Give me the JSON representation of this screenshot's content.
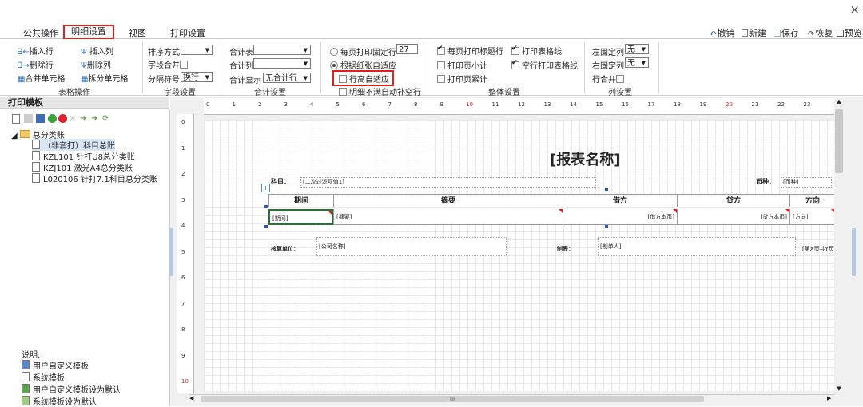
{
  "window": {
    "close": "×"
  },
  "tabs": [
    "公共操作",
    "明细设置",
    "视图",
    "打印设置"
  ],
  "toolbar": {
    "undo": "撤销",
    "new": "新建",
    "save": "保存",
    "restore": "恢复",
    "preview": "预览"
  },
  "ribbon": {
    "table_ops": {
      "insert_row": "插入行",
      "insert_col": "插入列",
      "delete_row": "删除行",
      "delete_col": "删除列",
      "merge_cell": "合并单元格",
      "split_cell": "拆分单元格",
      "group_label": "表格操作"
    },
    "field_settings": {
      "sort_label": "排序方式",
      "sort_value": "",
      "merge_label": "字段合并",
      "sep_label": "分隔符号",
      "sep_value": "换行",
      "group_label": "字段设置"
    },
    "total_settings": {
      "total_table": "合计表",
      "total_table_value": "",
      "total_col": "合计列",
      "total_col_value": "",
      "total_display": "合计显示",
      "total_display_value": "无合计行",
      "group_label": "合计设置"
    },
    "print_rows": {
      "fixed_rows": "每页打印固定行",
      "fixed_rows_value": "27",
      "fit_paper": "根据纸张自适应",
      "row_height_auto": "行高自适应",
      "detail_fill": "明细不满自动补空行"
    },
    "overall": {
      "print_title_each": "每页打印标题行",
      "print_page_subtotal": "打印页小计",
      "print_page_cumulative": "打印页累计",
      "print_table_lines": "打印表格线",
      "empty_row_lines": "空行打印表格线",
      "group_label": "整体设置"
    },
    "col_settings": {
      "left_fixed": "左固定列",
      "left_fixed_value": "无",
      "right_fixed": "右固定列",
      "right_fixed_value": "无",
      "row_merge": "行合并",
      "group_label": "列设置"
    }
  },
  "left_panel": {
    "title": "打印模板",
    "tree": {
      "root": "总分类账",
      "items": [
        "（非套打）科目总账",
        "KZL101 针打U8总分类账",
        "KZJ101 激光A4总分类账",
        "L020106 针打7.1科目总分类账"
      ]
    },
    "notes": {
      "heading": "说明:",
      "items": [
        "用户自定义模板",
        "系统模板",
        "用户自定义模板设为默认",
        "系统模板设为默认"
      ]
    }
  },
  "ruler": {
    "top": [
      "0",
      "1",
      "2",
      "3",
      "4",
      "5",
      "6",
      "7",
      "8",
      "9",
      "10",
      "11",
      "12",
      "13",
      "14",
      "15",
      "16",
      "17",
      "18",
      "19",
      "20",
      "21",
      "22",
      "23"
    ],
    "left": [
      "0",
      "1",
      "2",
      "3",
      "4",
      "5",
      "6",
      "7",
      "8",
      "9",
      "10"
    ]
  },
  "report": {
    "title": "[报表名称]",
    "subject_label": "科目：",
    "subject_value": "[二次过滤项值1]",
    "currency_label": "币种：",
    "currency_value": "[币种]",
    "headers": [
      "期间",
      "摘要",
      "借方",
      "贷方",
      "方向"
    ],
    "row": [
      "[期间]",
      "[摘要]",
      "[借方本币]",
      "[贷方本币]",
      "[方向]"
    ],
    "footer": {
      "unit_label": "核算单位：",
      "unit_value": "[公司名称]",
      "maker_label": "制表：",
      "maker_value": "[制单人]",
      "page_value": "[第X页共Y页"
    }
  },
  "scrollbar": {
    "grip": "III"
  }
}
